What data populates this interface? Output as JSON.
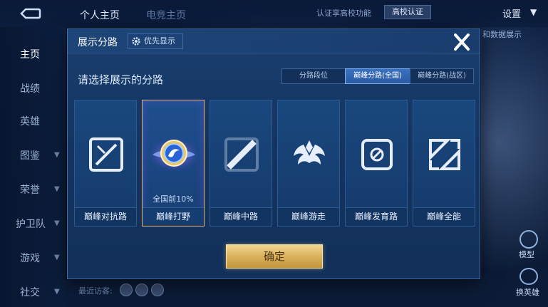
{
  "top": {
    "tabs": [
      "个人主页",
      "电竞主页"
    ],
    "cert_text": "认证享高校功能",
    "cert_button": "高校认证",
    "settings_label": "设置",
    "right_note": "和数据展示"
  },
  "side_nav": {
    "items": [
      "主页",
      "战绩",
      "英雄",
      "图鉴",
      "荣誉",
      "护卫队",
      "游戏",
      "社交"
    ],
    "active_index": 0
  },
  "bottom": {
    "visitors_label": "最近访客:",
    "model_label": "模型",
    "swap_label": "换英雄"
  },
  "modal": {
    "title": "展示分路",
    "priority_button": "优先显示",
    "subtitle": "请选择展示的分路",
    "segments": [
      "分路段位",
      "巅峰分路(全国)",
      "巅峰分路(战区)"
    ],
    "active_segment": 1,
    "lanes": [
      {
        "name": "巅峰对抗路",
        "rank": "",
        "selected": false
      },
      {
        "name": "巅峰打野",
        "rank": "全国前10%",
        "selected": true
      },
      {
        "name": "巅峰中路",
        "rank": "",
        "selected": false
      },
      {
        "name": "巅峰游走",
        "rank": "",
        "selected": false
      },
      {
        "name": "巅峰发育路",
        "rank": "",
        "selected": false
      },
      {
        "name": "巅峰全能",
        "rank": "",
        "selected": false
      }
    ],
    "confirm_button": "确定"
  },
  "colors": {
    "accent_gold": "#e7b36c",
    "active_segment": "#3a72c2",
    "modal_bg": "#1a3f70"
  }
}
